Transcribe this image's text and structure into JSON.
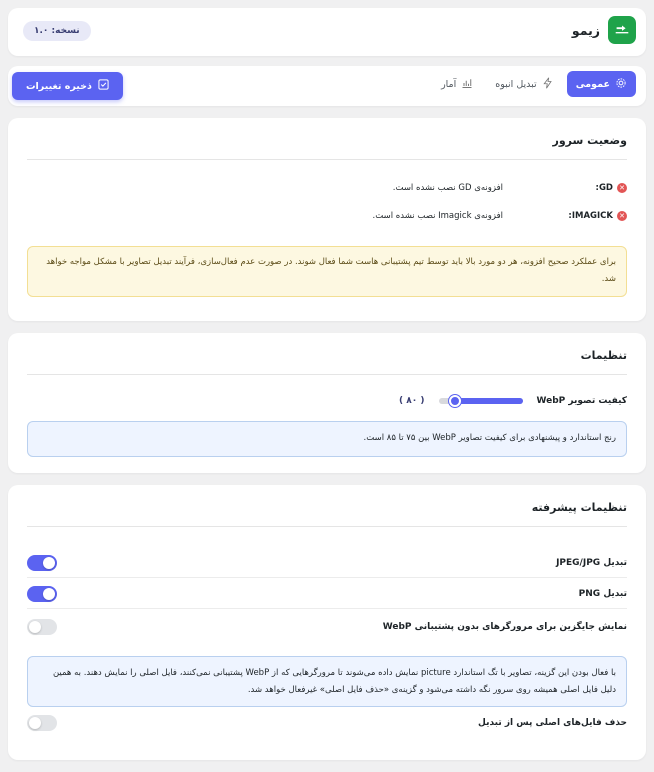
{
  "header": {
    "brand_name": "زیمو",
    "version": "نسخه: ۱.۰"
  },
  "nav": {
    "tabs": [
      {
        "label": "عمومی",
        "icon": "gear-icon",
        "active": true
      },
      {
        "label": "تبدیل انبوه",
        "icon": "bolt-icon",
        "active": false
      },
      {
        "label": "آمار",
        "icon": "chart-icon",
        "active": false
      }
    ],
    "save_label": "ذخیره تغییرات"
  },
  "server": {
    "title": "وضعیت سرور",
    "items": [
      {
        "name": "GD:",
        "message": "افزونه‌ی GD نصب نشده است."
      },
      {
        "name": "IMAGICK:",
        "message": "افزونه‌ی Imagick نصب نشده است."
      }
    ],
    "warning": "برای عملکرد صحیح افزونه، هر دو مورد بالا باید توسط تیم پشتیبانی هاست شما فعال شوند. در صورت عدم فعال‌سازی، فرآیند تبدیل تصاویر با مشکل مواجه خواهد شد."
  },
  "settings": {
    "title": "تنظیمات",
    "quality_label": "کیفیت تصویر WebP",
    "quality_value": "( ۸۰ )",
    "quality_level": 0.8,
    "info": "رنج استاندارد و پیشنهادی برای کیفیت تصاویر WebP بین ۷۵ تا ۸۵ است."
  },
  "advanced": {
    "title": "تنظیمات پیشرفته",
    "toggles": [
      {
        "label": "تبدیل JPEG/JPG",
        "on": true
      },
      {
        "label": "تبدیل PNG",
        "on": true
      },
      {
        "label": "نمایش جایگزین برای مرورگرهای بدون پشتیبانی WebP",
        "on": false
      }
    ],
    "info": "با فعال بودن این گزینه، تصاویر با تگ استاندارد picture نمایش داده می‌شوند تا مرورگرهایی که از WebP پشتیبانی نمی‌کنند، فایل اصلی را نمایش دهند. به همین دلیل فایل اصلی همیشه روی سرور نگه داشته می‌شود و گزینه‌ی «حذف فایل اصلی» غیرفعال خواهد شد.",
    "delete_label": "حذف فایل‌های اصلی پس از تبدیل",
    "delete_on": false
  },
  "colors": {
    "accent": "#5b63f1",
    "brand_green": "#1fa34a",
    "error": "#e25555",
    "warning_bg": "#fdf8e1",
    "info_bg": "#eef4ff"
  }
}
